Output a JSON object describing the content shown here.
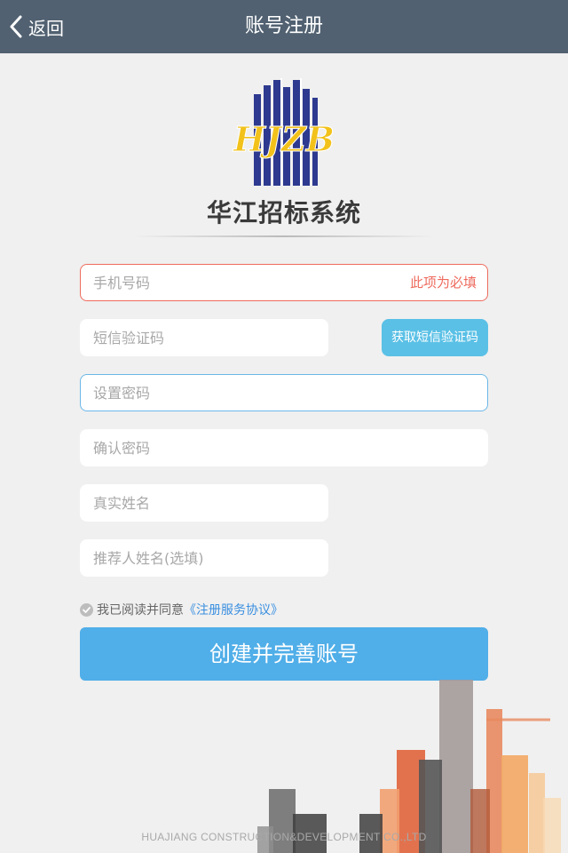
{
  "header": {
    "back_label": "返回",
    "title": "账号注册"
  },
  "brand": {
    "logo_text": "HJZB",
    "name": "华江招标系统"
  },
  "form": {
    "phone": {
      "placeholder": "手机号码",
      "value": "",
      "error": "此项为必填"
    },
    "sms_code": {
      "placeholder": "短信验证码",
      "value": ""
    },
    "sms_button": "获取短信验证码",
    "password": {
      "placeholder": "设置密码",
      "value": ""
    },
    "confirm_password": {
      "placeholder": "确认密码",
      "value": ""
    },
    "real_name": {
      "placeholder": "真实姓名",
      "value": ""
    },
    "referrer": {
      "placeholder": "推荐人姓名(选填)",
      "value": ""
    }
  },
  "agreement": {
    "text": "我已阅读并同意",
    "link": "《注册服务协议》",
    "checked": true
  },
  "submit_label": "创建并完善账号",
  "footer": "HUAJIANG CONSTRUCTION&DEVELOPMENT CO.,LTD",
  "colors": {
    "header_bg": "#516171",
    "error": "#ee6b5e",
    "primary_button": "#50aee8",
    "sms_button": "#5ac0e6",
    "link": "#3a8fe0"
  },
  "icons": {
    "back": "chevron-left-icon",
    "check": "check-circle-icon"
  }
}
